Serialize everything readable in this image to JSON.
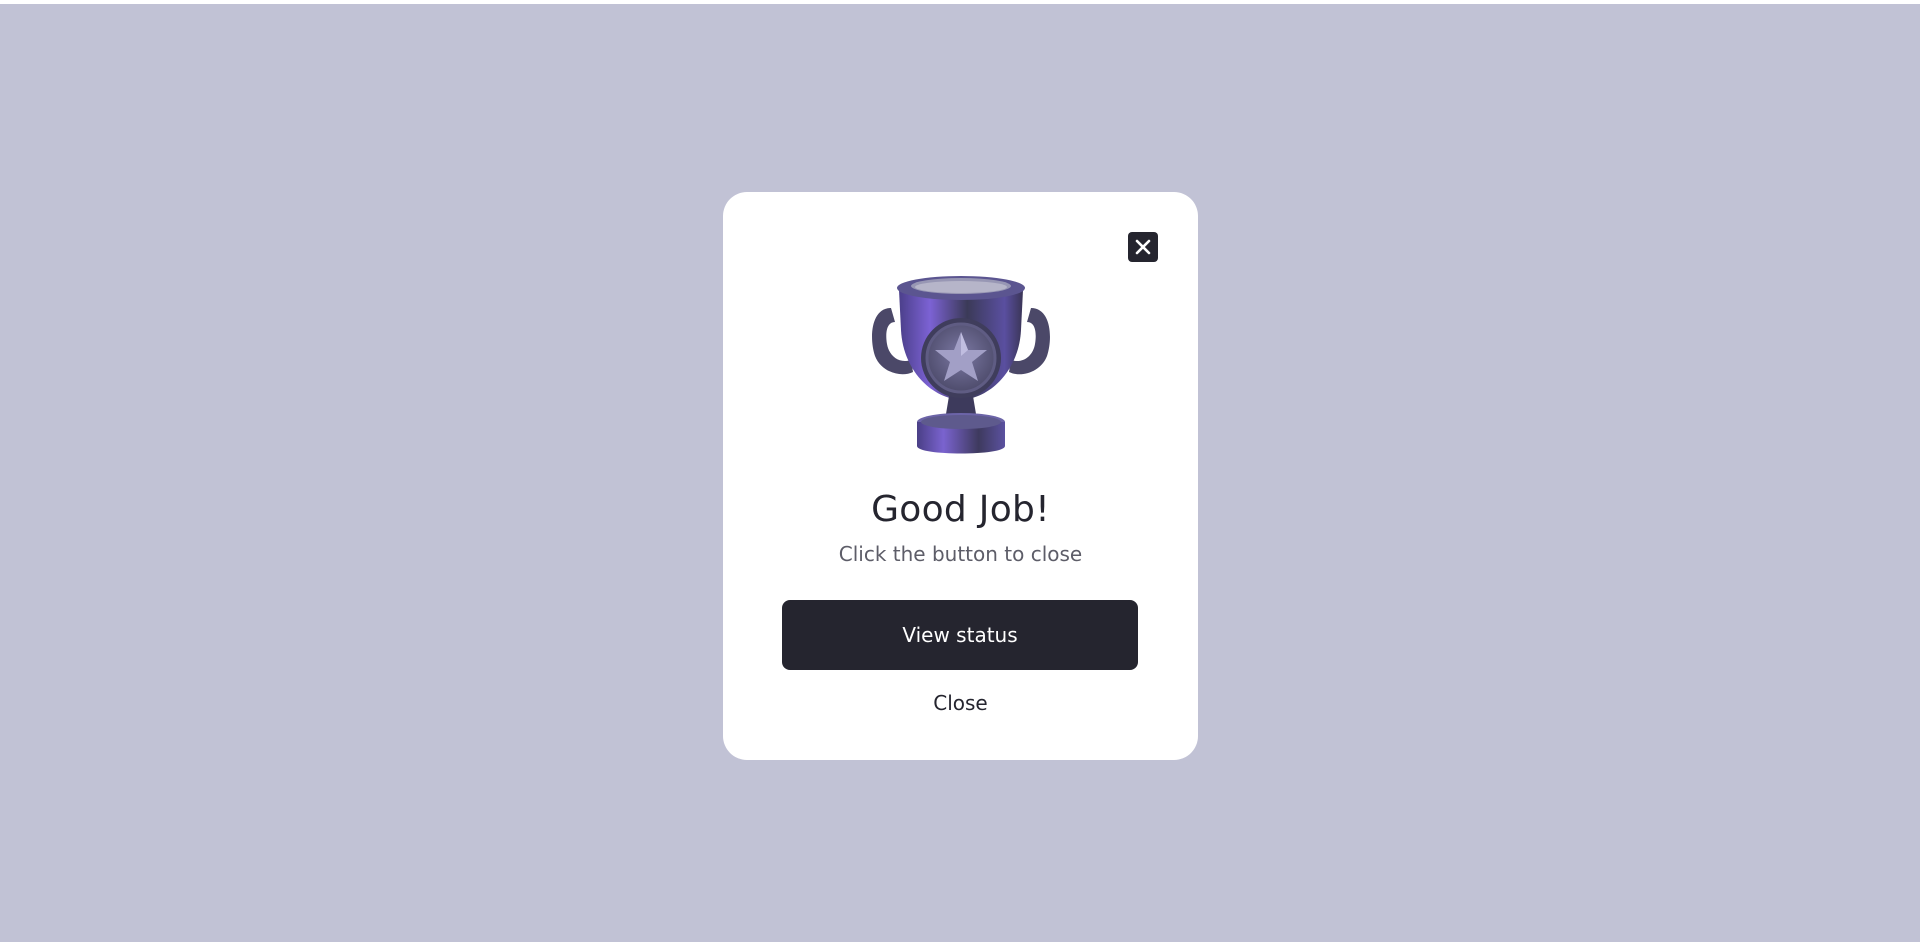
{
  "modal": {
    "title": "Good Job!",
    "subtitle": "Click the button to close",
    "primary_button_label": "View status",
    "secondary_button_label": "Close",
    "close_icon": "close-icon",
    "illustration_icon": "trophy-icon"
  },
  "colors": {
    "backdrop": "#c1c2d5",
    "surface": "#ffffff",
    "primary": "#25252f",
    "text_secondary": "#5d5d68",
    "trophy": "#6b5fb5"
  }
}
